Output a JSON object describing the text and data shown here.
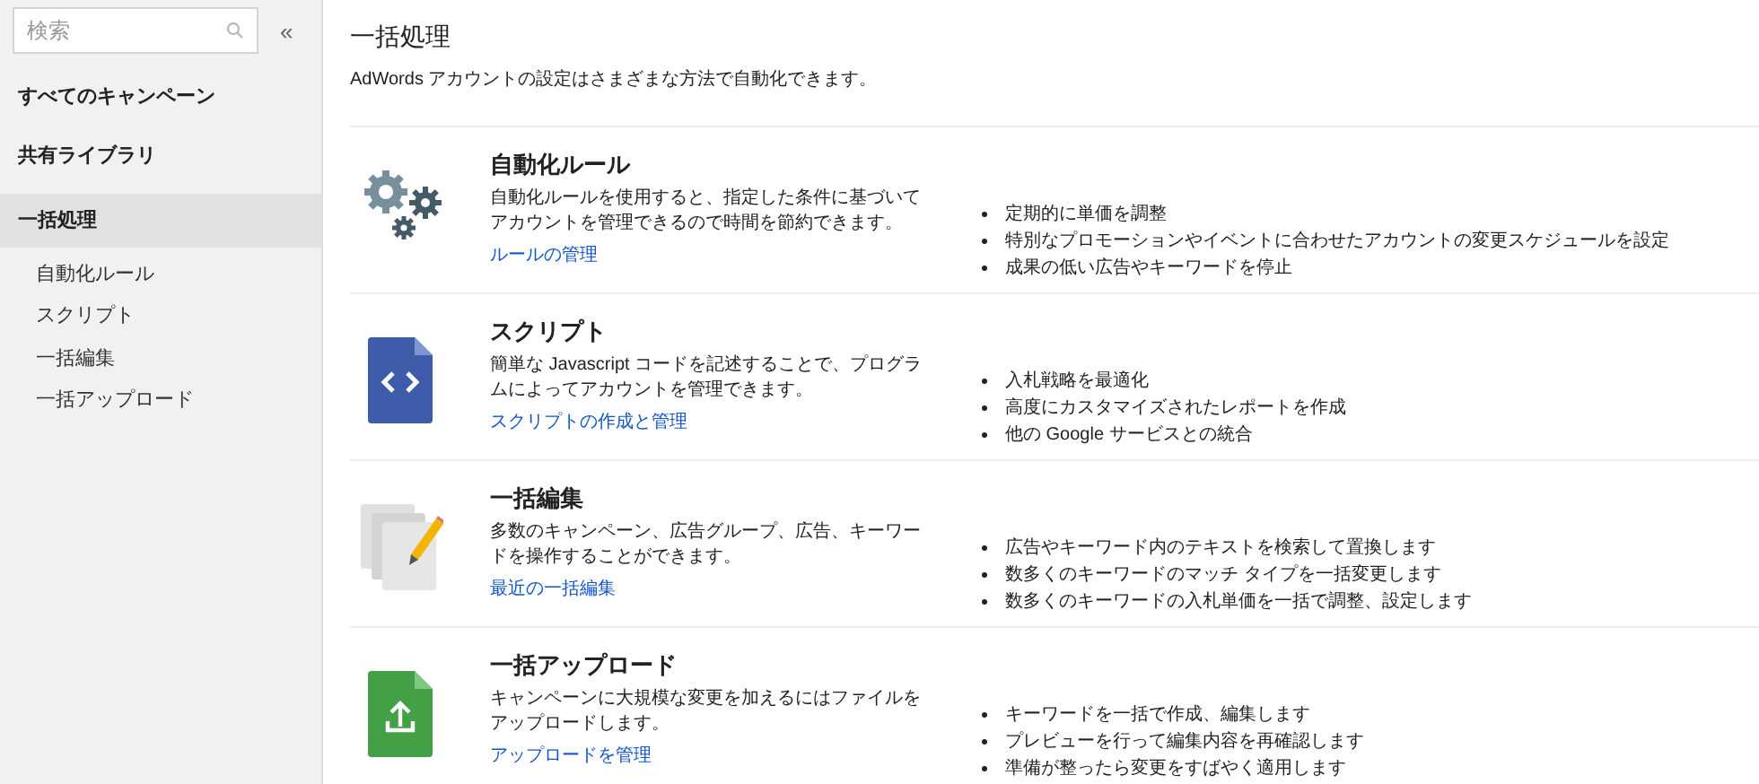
{
  "sidebar": {
    "search": {
      "placeholder": "検索"
    },
    "collapse": "«",
    "items": [
      {
        "label": "すべてのキャンペーン",
        "selected": false
      },
      {
        "label": "共有ライブラリ",
        "selected": false
      },
      {
        "label": "一括処理",
        "selected": true,
        "children": [
          {
            "label": "自動化ルール"
          },
          {
            "label": "スクリプト"
          },
          {
            "label": "一括編集"
          },
          {
            "label": "一括アップロード"
          }
        ]
      }
    ]
  },
  "page": {
    "title": "一括処理",
    "subtitle": "AdWords アカウントの設定はさまざまな方法で自動化できます。"
  },
  "sections": [
    {
      "kind": "gears",
      "title": "自動化ルール",
      "description": "自動化ルールを使用すると、指定した条件に基づいてアカウントを管理できるので時間を節約できます。",
      "link": "ルールの管理",
      "bullets": [
        "定期的に単価を調整",
        "特別なプロモーションやイベントに合わせたアカウントの変更スケジュールを設定",
        "成果の低い広告やキーワードを停止"
      ]
    },
    {
      "kind": "script",
      "title": "スクリプト",
      "description": "簡単な Javascript コードを記述することで、プログラムによってアカウントを管理できます。",
      "link": "スクリプトの作成と管理",
      "bullets": [
        "入札戦略を最適化",
        "高度にカスタマイズされたレポートを作成",
        "他の Google サービスとの統合"
      ]
    },
    {
      "kind": "edit",
      "title": "一括編集",
      "description": "多数のキャンペーン、広告グループ、広告、キーワードを操作することができます。",
      "link": "最近の一括編集",
      "bullets": [
        "広告やキーワード内のテキストを検索して置換します",
        "数多くのキーワードのマッチ タイプを一括変更します",
        "数多くのキーワードの入札単価を一括で調整、設定します"
      ]
    },
    {
      "kind": "upload",
      "title": "一括アップロード",
      "description": "キャンペーンに大規模な変更を加えるにはファイルをアップロードします。",
      "link": "アップロードを管理",
      "bullets": [
        "キーワードを一括で作成、編集します",
        "プレビューを行って編集内容を再確認します",
        "準備が整ったら変更をすばやく適用します"
      ]
    }
  ]
}
